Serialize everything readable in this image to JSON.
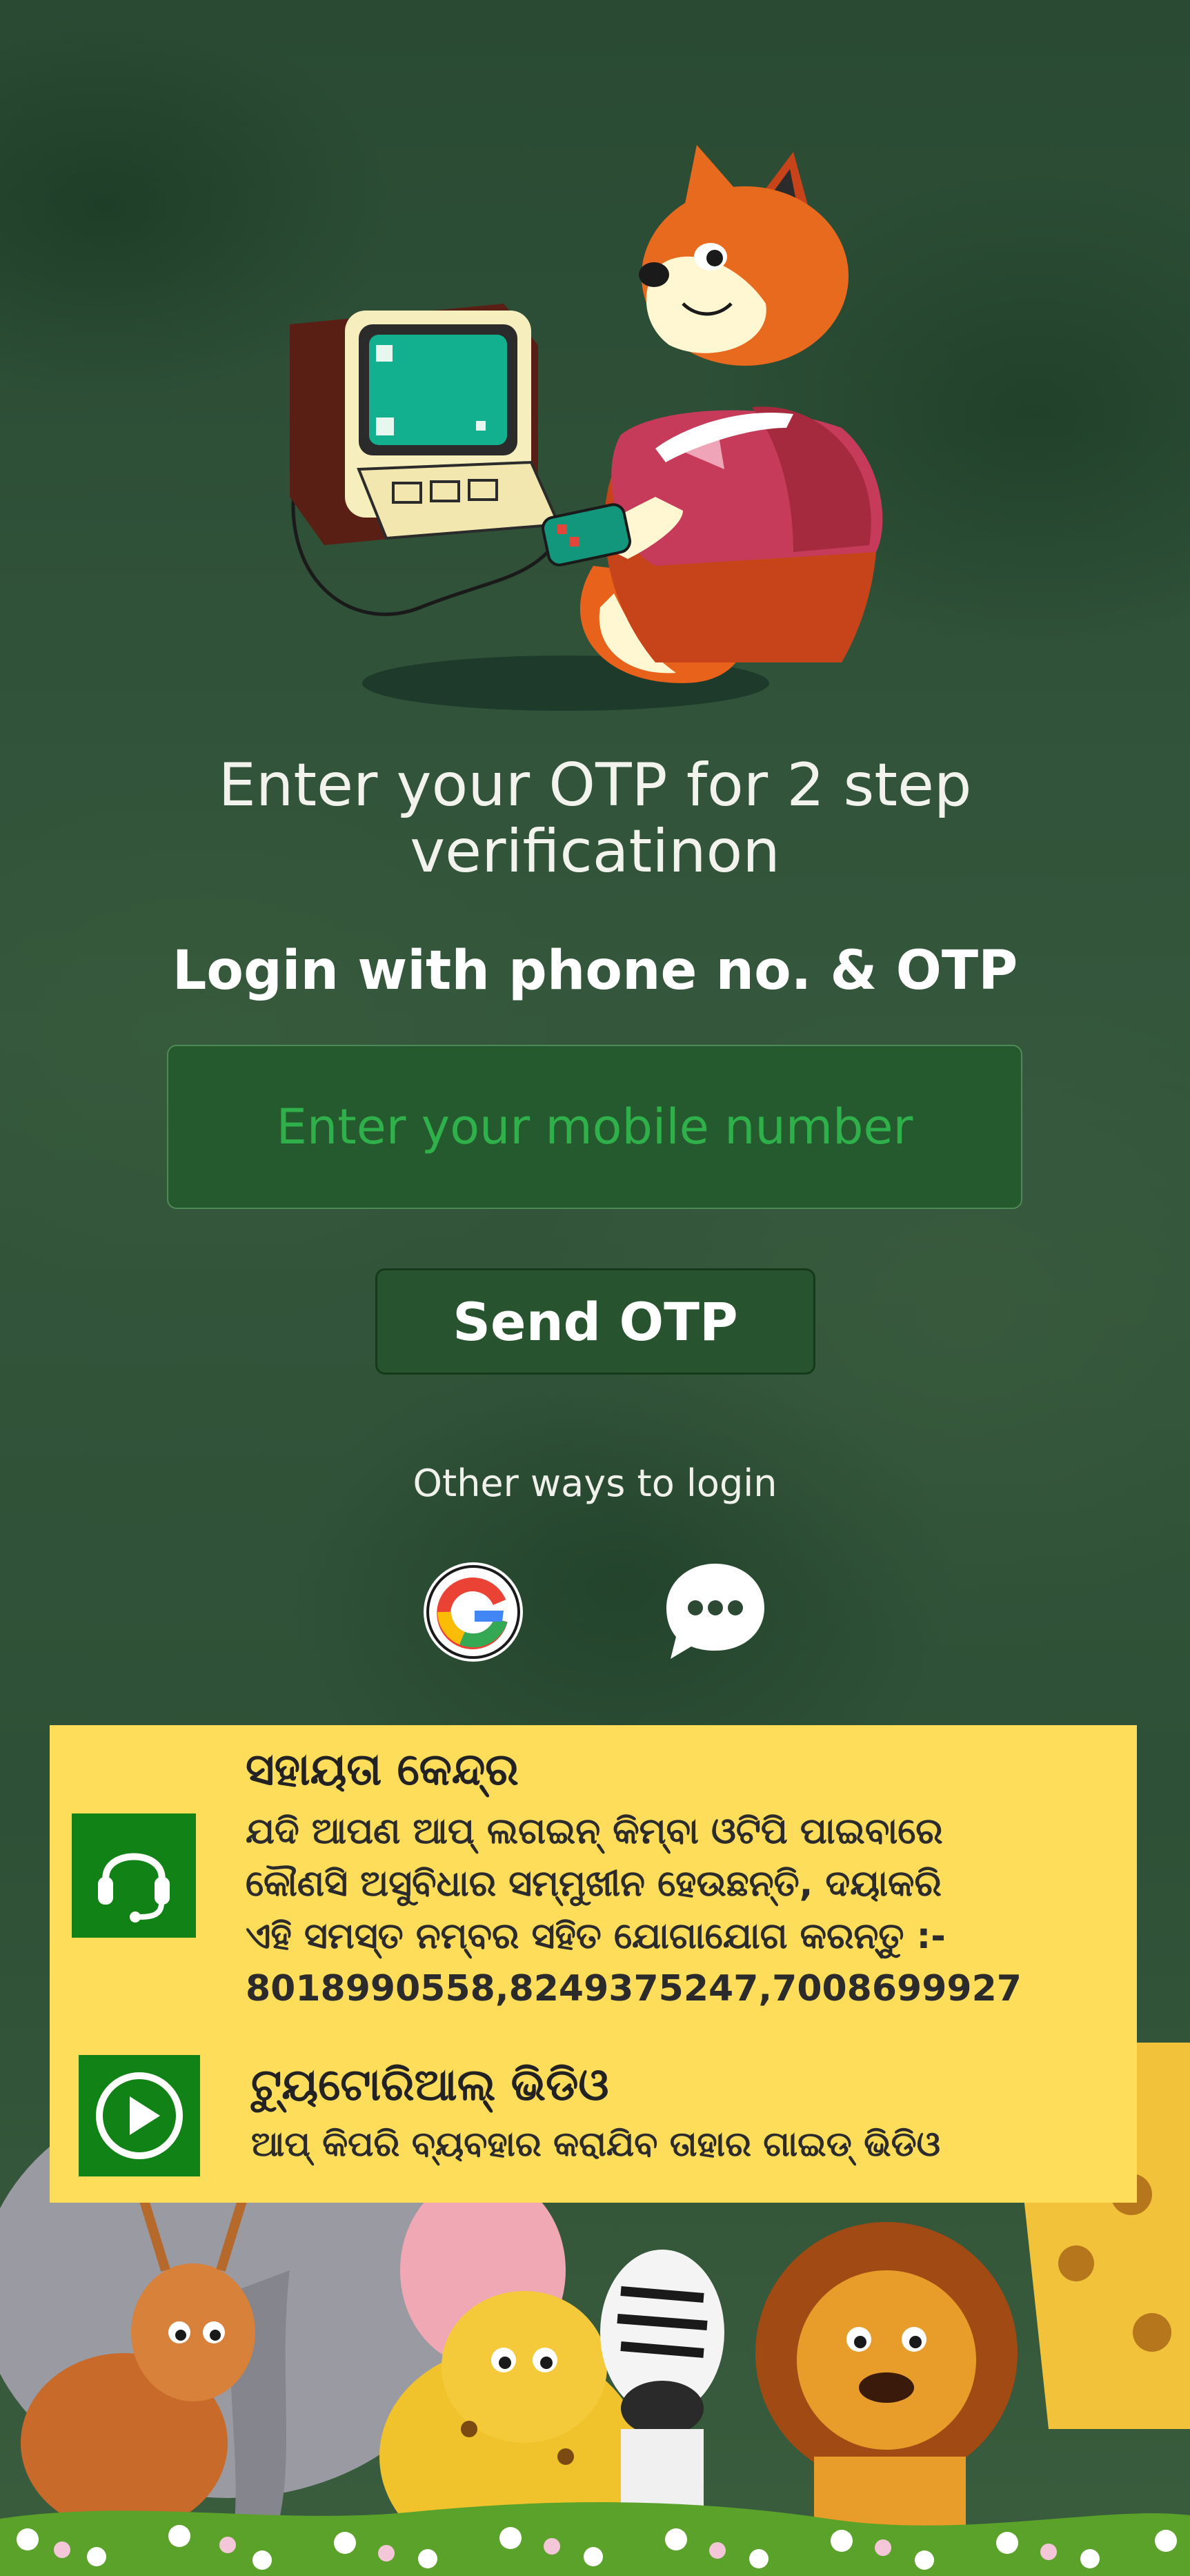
{
  "screen": {
    "title": "Enter your OTP for 2 step verificatinon",
    "subtitle": "Login with phone no. & OTP"
  },
  "login_form": {
    "phone_placeholder": "Enter your mobile number",
    "phone_value": "",
    "send_otp_label": "Send OTP"
  },
  "other_login": {
    "label": "Other ways to login",
    "options": [
      {
        "icon": "google-icon"
      },
      {
        "icon": "chat-bubble-icon"
      }
    ]
  },
  "help_center": {
    "icon": "headset-icon",
    "title": "ସହାୟତା କେନ୍ଦ୍ର",
    "body_lines": [
      "ଯଦି ଆପଣ ଆପ୍ ଲଗଇନ୍ କିମ୍ବା ଓଟିପି ପାଇବାରେ",
      "କୌଣସି ଅସୁବିଧାର ସମ୍ମୁଖୀନ ହେଉଛନ୍ତି, ଦୟାକରି",
      "ଏହି ସମସ୍ତ ନମ୍ବର ସହିତ ଯୋଗାଯୋଗ କରନ୍ତୁ :-",
      "8018990558,8249375247,7008699927"
    ]
  },
  "tutorial_video": {
    "icon": "play-icon",
    "title": "ଟ୍ୟୁଟୋରିଆଲ୍ ଭିଡିଓ",
    "subtitle": "ଆପ୍ କିପରି ବ୍ୟବହାର କରାଯିବ ତାହାର ଗାଇଡ୍ ଭିଡିଓ"
  },
  "colors": {
    "background": "#2c4a33",
    "input_bg": "#245a2d",
    "input_text": "#2fb04a",
    "button_bg": "#27542f",
    "panel_yellow": "#fedd5a",
    "icon_green": "#118216"
  }
}
